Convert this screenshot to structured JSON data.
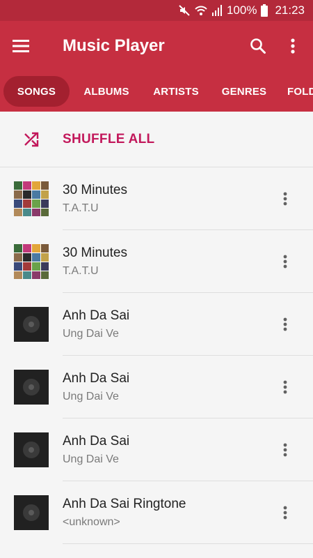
{
  "status_bar": {
    "icons": [
      "mute-icon",
      "wifi-icon",
      "signal-icon"
    ],
    "battery": "100%",
    "battery_icon": "battery-icon",
    "time": "21:23"
  },
  "app_bar": {
    "title": "Music Player",
    "menu_icon": "menu-icon",
    "search_icon": "search-icon",
    "more_icon": "more-vert-icon",
    "color": "#c62f41"
  },
  "tabs": [
    {
      "label": "SONGS",
      "active": true
    },
    {
      "label": "ALBUMS",
      "active": false
    },
    {
      "label": "ARTISTS",
      "active": false
    },
    {
      "label": "GENRES",
      "active": false
    },
    {
      "label": "FOLDERS",
      "active": false
    }
  ],
  "shuffle": {
    "label": "SHUFFLE ALL",
    "icon": "shuffle-icon",
    "color": "#c2185b"
  },
  "songs": [
    {
      "title": "30 Minutes",
      "artist": "T.A.T.U",
      "art": "album-collage"
    },
    {
      "title": "30 Minutes",
      "artist": "T.A.T.U",
      "art": "album-collage"
    },
    {
      "title": "Anh Da Sai",
      "artist": "Ung Dai Ve",
      "art": "default-disc"
    },
    {
      "title": "Anh Da Sai",
      "artist": "Ung Dai Ve",
      "art": "default-disc"
    },
    {
      "title": "Anh Da Sai",
      "artist": "Ung Dai Ve",
      "art": "default-disc"
    },
    {
      "title": "Anh Da Sai Ringtone",
      "artist": "<unknown>",
      "art": "default-disc"
    }
  ]
}
